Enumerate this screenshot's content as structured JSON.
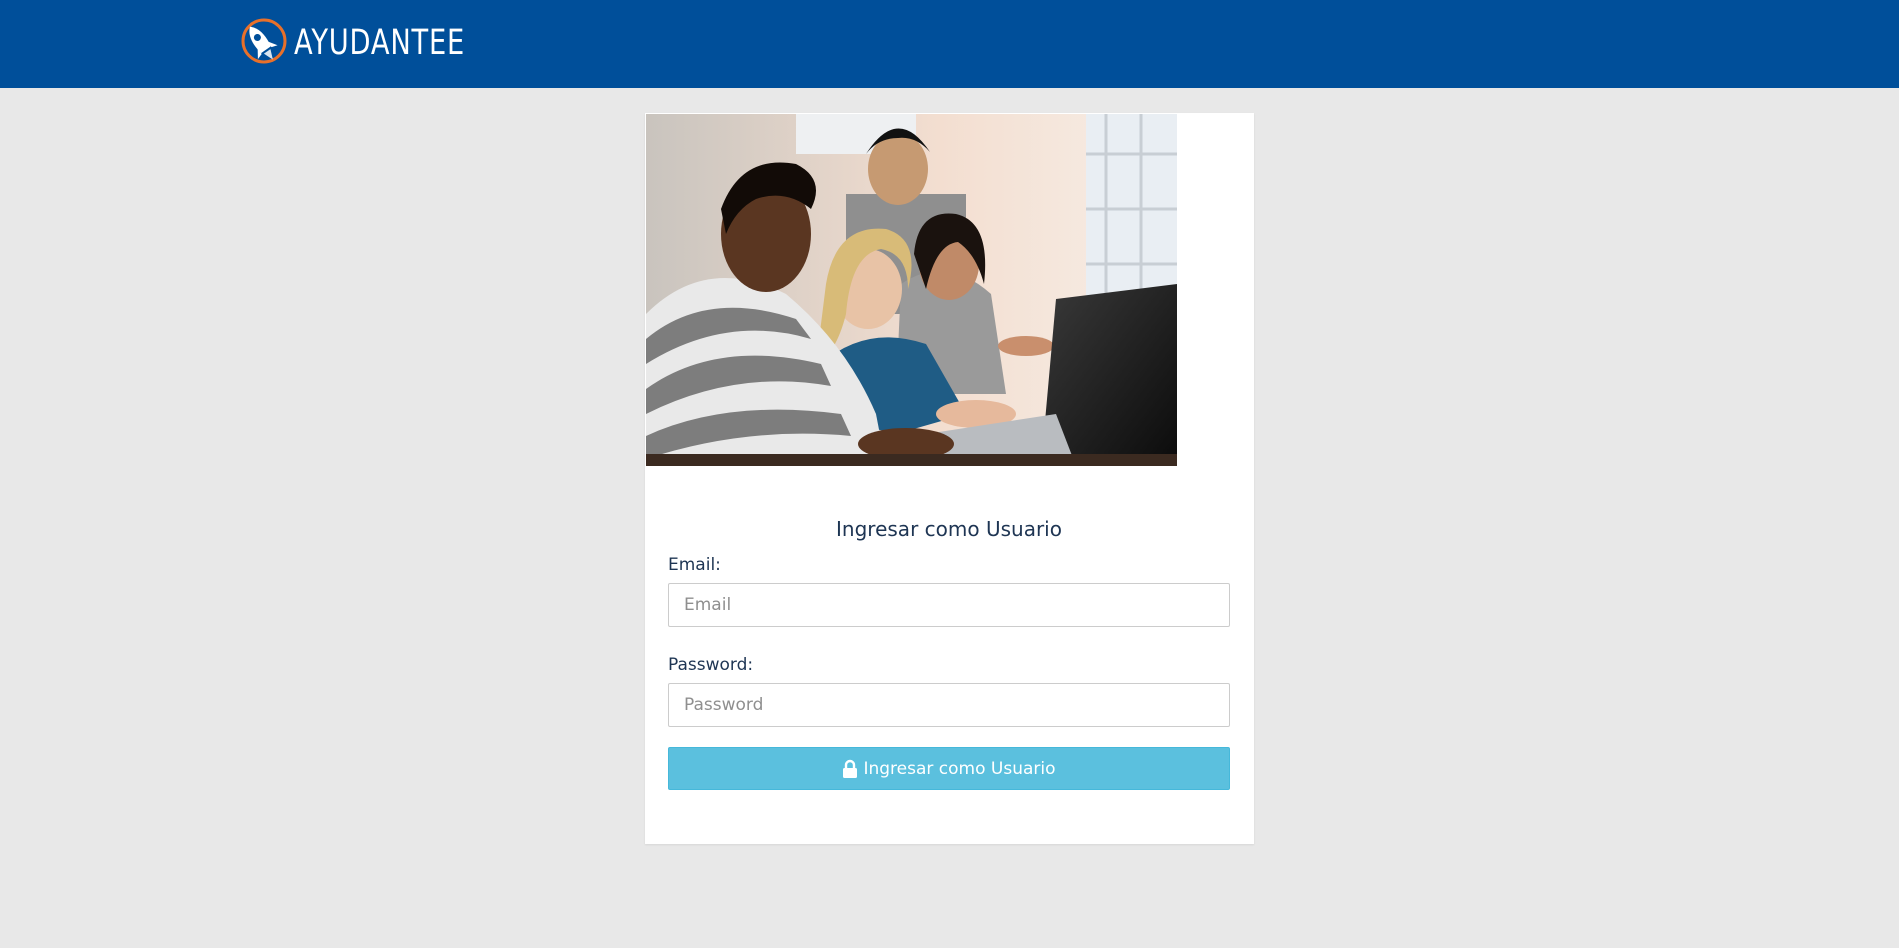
{
  "header": {
    "brand_name": "AYUDANTEE",
    "brand_icon": "rocket-icon",
    "background_color": "#004f9a"
  },
  "hero": {
    "image_alt": "students-with-laptop-photo"
  },
  "login": {
    "title": "Ingresar como Usuario",
    "email_label": "Email:",
    "email_placeholder": "Email",
    "email_value": "",
    "password_label": "Password:",
    "password_placeholder": "Password",
    "password_value": "",
    "submit_label": "Ingresar como Usuario",
    "submit_icon": "lock-icon",
    "submit_color": "#5bc0de"
  }
}
